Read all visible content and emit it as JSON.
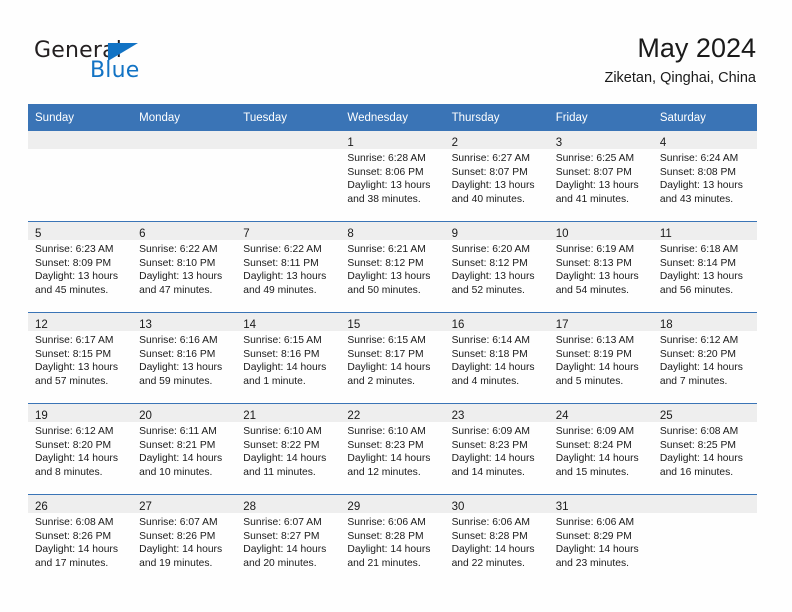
{
  "brand": {
    "name_top": "General",
    "name_bottom": "Blue",
    "accent_color": "#1273c4"
  },
  "header": {
    "title": "May 2024",
    "subtitle": "Ziketan, Qinghai, China"
  },
  "theme": {
    "header_blue": "#3a74b6",
    "daynum_band": "#eeeeee",
    "page_bg": "#fefefe",
    "text": "#1a1a1a"
  },
  "calendar": {
    "weekday_headers": [
      "Sunday",
      "Monday",
      "Tuesday",
      "Wednesday",
      "Thursday",
      "Friday",
      "Saturday"
    ],
    "weeks": [
      [
        {
          "day": "",
          "lines": []
        },
        {
          "day": "",
          "lines": []
        },
        {
          "day": "",
          "lines": []
        },
        {
          "day": "1",
          "lines": [
            "Sunrise: 6:28 AM",
            "Sunset: 8:06 PM",
            "Daylight: 13 hours",
            "and 38 minutes."
          ]
        },
        {
          "day": "2",
          "lines": [
            "Sunrise: 6:27 AM",
            "Sunset: 8:07 PM",
            "Daylight: 13 hours",
            "and 40 minutes."
          ]
        },
        {
          "day": "3",
          "lines": [
            "Sunrise: 6:25 AM",
            "Sunset: 8:07 PM",
            "Daylight: 13 hours",
            "and 41 minutes."
          ]
        },
        {
          "day": "4",
          "lines": [
            "Sunrise: 6:24 AM",
            "Sunset: 8:08 PM",
            "Daylight: 13 hours",
            "and 43 minutes."
          ]
        }
      ],
      [
        {
          "day": "5",
          "lines": [
            "Sunrise: 6:23 AM",
            "Sunset: 8:09 PM",
            "Daylight: 13 hours",
            "and 45 minutes."
          ]
        },
        {
          "day": "6",
          "lines": [
            "Sunrise: 6:22 AM",
            "Sunset: 8:10 PM",
            "Daylight: 13 hours",
            "and 47 minutes."
          ]
        },
        {
          "day": "7",
          "lines": [
            "Sunrise: 6:22 AM",
            "Sunset: 8:11 PM",
            "Daylight: 13 hours",
            "and 49 minutes."
          ]
        },
        {
          "day": "8",
          "lines": [
            "Sunrise: 6:21 AM",
            "Sunset: 8:12 PM",
            "Daylight: 13 hours",
            "and 50 minutes."
          ]
        },
        {
          "day": "9",
          "lines": [
            "Sunrise: 6:20 AM",
            "Sunset: 8:12 PM",
            "Daylight: 13 hours",
            "and 52 minutes."
          ]
        },
        {
          "day": "10",
          "lines": [
            "Sunrise: 6:19 AM",
            "Sunset: 8:13 PM",
            "Daylight: 13 hours",
            "and 54 minutes."
          ]
        },
        {
          "day": "11",
          "lines": [
            "Sunrise: 6:18 AM",
            "Sunset: 8:14 PM",
            "Daylight: 13 hours",
            "and 56 minutes."
          ]
        }
      ],
      [
        {
          "day": "12",
          "lines": [
            "Sunrise: 6:17 AM",
            "Sunset: 8:15 PM",
            "Daylight: 13 hours",
            "and 57 minutes."
          ]
        },
        {
          "day": "13",
          "lines": [
            "Sunrise: 6:16 AM",
            "Sunset: 8:16 PM",
            "Daylight: 13 hours",
            "and 59 minutes."
          ]
        },
        {
          "day": "14",
          "lines": [
            "Sunrise: 6:15 AM",
            "Sunset: 8:16 PM",
            "Daylight: 14 hours",
            "and 1 minute."
          ]
        },
        {
          "day": "15",
          "lines": [
            "Sunrise: 6:15 AM",
            "Sunset: 8:17 PM",
            "Daylight: 14 hours",
            "and 2 minutes."
          ]
        },
        {
          "day": "16",
          "lines": [
            "Sunrise: 6:14 AM",
            "Sunset: 8:18 PM",
            "Daylight: 14 hours",
            "and 4 minutes."
          ]
        },
        {
          "day": "17",
          "lines": [
            "Sunrise: 6:13 AM",
            "Sunset: 8:19 PM",
            "Daylight: 14 hours",
            "and 5 minutes."
          ]
        },
        {
          "day": "18",
          "lines": [
            "Sunrise: 6:12 AM",
            "Sunset: 8:20 PM",
            "Daylight: 14 hours",
            "and 7 minutes."
          ]
        }
      ],
      [
        {
          "day": "19",
          "lines": [
            "Sunrise: 6:12 AM",
            "Sunset: 8:20 PM",
            "Daylight: 14 hours",
            "and 8 minutes."
          ]
        },
        {
          "day": "20",
          "lines": [
            "Sunrise: 6:11 AM",
            "Sunset: 8:21 PM",
            "Daylight: 14 hours",
            "and 10 minutes."
          ]
        },
        {
          "day": "21",
          "lines": [
            "Sunrise: 6:10 AM",
            "Sunset: 8:22 PM",
            "Daylight: 14 hours",
            "and 11 minutes."
          ]
        },
        {
          "day": "22",
          "lines": [
            "Sunrise: 6:10 AM",
            "Sunset: 8:23 PM",
            "Daylight: 14 hours",
            "and 12 minutes."
          ]
        },
        {
          "day": "23",
          "lines": [
            "Sunrise: 6:09 AM",
            "Sunset: 8:23 PM",
            "Daylight: 14 hours",
            "and 14 minutes."
          ]
        },
        {
          "day": "24",
          "lines": [
            "Sunrise: 6:09 AM",
            "Sunset: 8:24 PM",
            "Daylight: 14 hours",
            "and 15 minutes."
          ]
        },
        {
          "day": "25",
          "lines": [
            "Sunrise: 6:08 AM",
            "Sunset: 8:25 PM",
            "Daylight: 14 hours",
            "and 16 minutes."
          ]
        }
      ],
      [
        {
          "day": "26",
          "lines": [
            "Sunrise: 6:08 AM",
            "Sunset: 8:26 PM",
            "Daylight: 14 hours",
            "and 17 minutes."
          ]
        },
        {
          "day": "27",
          "lines": [
            "Sunrise: 6:07 AM",
            "Sunset: 8:26 PM",
            "Daylight: 14 hours",
            "and 19 minutes."
          ]
        },
        {
          "day": "28",
          "lines": [
            "Sunrise: 6:07 AM",
            "Sunset: 8:27 PM",
            "Daylight: 14 hours",
            "and 20 minutes."
          ]
        },
        {
          "day": "29",
          "lines": [
            "Sunrise: 6:06 AM",
            "Sunset: 8:28 PM",
            "Daylight: 14 hours",
            "and 21 minutes."
          ]
        },
        {
          "day": "30",
          "lines": [
            "Sunrise: 6:06 AM",
            "Sunset: 8:28 PM",
            "Daylight: 14 hours",
            "and 22 minutes."
          ]
        },
        {
          "day": "31",
          "lines": [
            "Sunrise: 6:06 AM",
            "Sunset: 8:29 PM",
            "Daylight: 14 hours",
            "and 23 minutes."
          ]
        },
        {
          "day": "",
          "lines": []
        }
      ]
    ]
  }
}
